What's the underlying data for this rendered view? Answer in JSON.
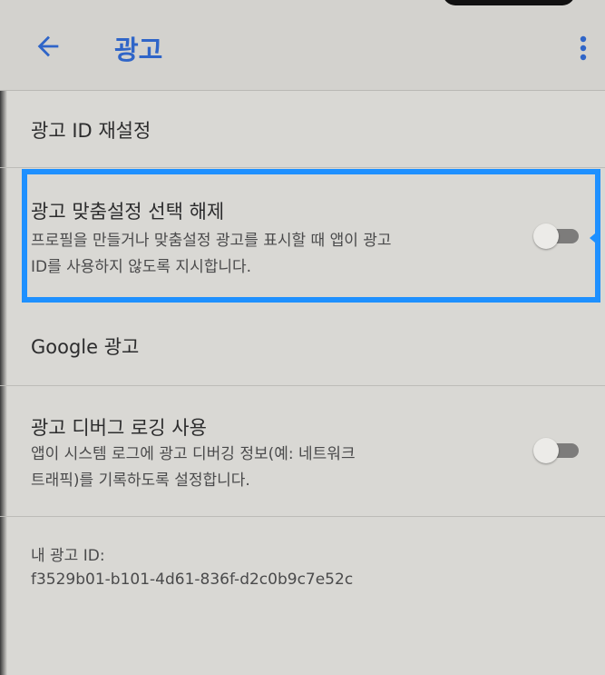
{
  "header": {
    "title": "광고",
    "back_icon": "arrow-left-icon",
    "more_icon": "more-vert-icon"
  },
  "settings": {
    "reset_ad_id": {
      "title": "광고 ID 재설정"
    },
    "opt_out": {
      "title": "광고 맞춤설정 선택 해제",
      "desc_line1": "프로필을 만들거나 맞춤설정 광고를 표시할 때 앱이 광고",
      "desc_line2": "ID를 사용하지 않도록 지시합니다.",
      "enabled": false
    },
    "google_ads": {
      "title": "Google 광고"
    },
    "debug_logging": {
      "title": "광고 디버그 로깅 사용",
      "desc_line1": "앱이 시스템 로그에 광고 디버깅 정보(예: 네트워크",
      "desc_line2": "트래픽)를 기록하도록 설정합니다.",
      "enabled": false
    },
    "my_ad_id": {
      "label": "내 광고 ID:",
      "value": "f3529b01-b101-4d61-836f-d2c0b9c7e52c"
    }
  },
  "colors": {
    "accent": "#2f65c8",
    "highlight": "#1e90ff"
  }
}
